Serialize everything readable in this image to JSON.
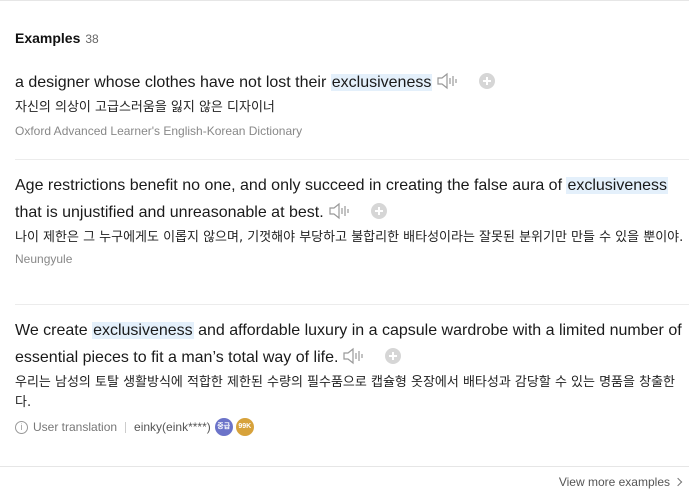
{
  "header": {
    "title": "Examples",
    "count": "38"
  },
  "examples": [
    {
      "sentence": {
        "before": "a designer whose clothes have not lost their ",
        "keyword": "exclusiveness",
        "after": ""
      },
      "translation": "자신의 의상이 고급스러움을 잃지 않은 디자이너",
      "source": "Oxford Advanced Learner's English-Korean Dictionary"
    },
    {
      "sentence": {
        "before": "Age restrictions benefit no one, and only succeed in creating the false aura of ",
        "keyword": "exclusiveness",
        "after": " that is unjustified and unreasonable at best."
      },
      "translation": "나이 제한은 그 누구에게도 이롭지 않으며, 기껏해야 부당하고 불합리한 배타성이라는 잘못된 분위기만 만들 수 있을 뿐이야.",
      "source": "Neungyule"
    },
    {
      "sentence": {
        "before": "We create ",
        "keyword": "exclusiveness",
        "after": " and affordable luxury in a capsule wardrobe with a limited number of essential pieces to fit a man’s total way of life."
      },
      "translation": "우리는 남성의 토탈 생활방식에 적합한 제한된 수량의 필수품으로 캡슐형 옷장에서 배타성과 감당할 수 있는 명품을 창출한다.",
      "user": {
        "label": "User translation",
        "name": "einky(eink****)",
        "level_badge": "중급 10",
        "points_badge": "99K"
      }
    }
  ],
  "footer": {
    "more_label": "View more examples"
  },
  "colors": {
    "highlight": "#e4f0fb",
    "level_badge": "#6b73c9",
    "points_badge": "#d7a23b"
  }
}
